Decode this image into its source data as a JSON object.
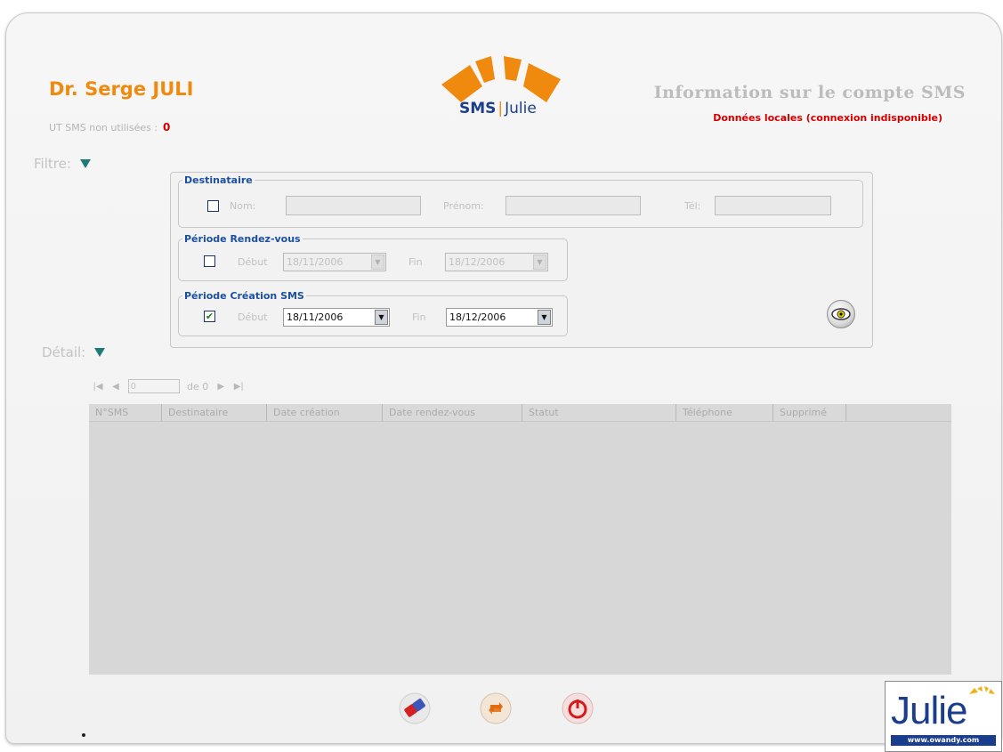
{
  "header": {
    "doctor_name": "Dr. Serge JULI",
    "ut_label": "UT SMS non utilisées :",
    "ut_value": "0",
    "logo_text_sms": "SMS",
    "logo_text_julie": "Julie",
    "title": "Information sur le compte SMS",
    "status": "Données locales (connexion indisponible)"
  },
  "filter": {
    "label": "Filtre:",
    "destinataire": {
      "legend": "Destinataire",
      "checked": false,
      "nom_label": "Nom:",
      "nom_value": "",
      "prenom_label": "Prénom:",
      "prenom_value": "",
      "tel_label": "Tél:",
      "tel_value": ""
    },
    "periode_rdv": {
      "legend": "Période Rendez-vous",
      "checked": false,
      "debut_label": "Début",
      "debut_value": "18/11/2006",
      "fin_label": "Fin",
      "fin_value": "18/12/2006"
    },
    "periode_creation": {
      "legend": "Période Création SMS",
      "checked": true,
      "checkmark": "✔",
      "debut_label": "Début",
      "debut_value": "18/11/2006",
      "fin_label": "Fin",
      "fin_value": "18/12/2006"
    },
    "search_icon": "eye-icon"
  },
  "detail": {
    "label": "Détail:",
    "pager": {
      "first": "|◀",
      "prev": "◀",
      "page_value": "0",
      "of_text": "de 0",
      "next": "▶",
      "last": "▶|"
    },
    "columns": [
      "N°SMS",
      "Destinataire",
      "Date création",
      "Date rendez-vous",
      "Statut",
      "Téléphone",
      "Supprimé"
    ]
  },
  "footer": {
    "buttons": [
      "eraser-icon",
      "refresh-icon",
      "power-icon"
    ]
  },
  "brand": {
    "word": "Julie",
    "url": "www.owandy.com"
  },
  "colors": {
    "orange": "#f08a0e",
    "navy": "#1b3e8c",
    "red": "#d40000",
    "teal": "#1e7a78"
  }
}
